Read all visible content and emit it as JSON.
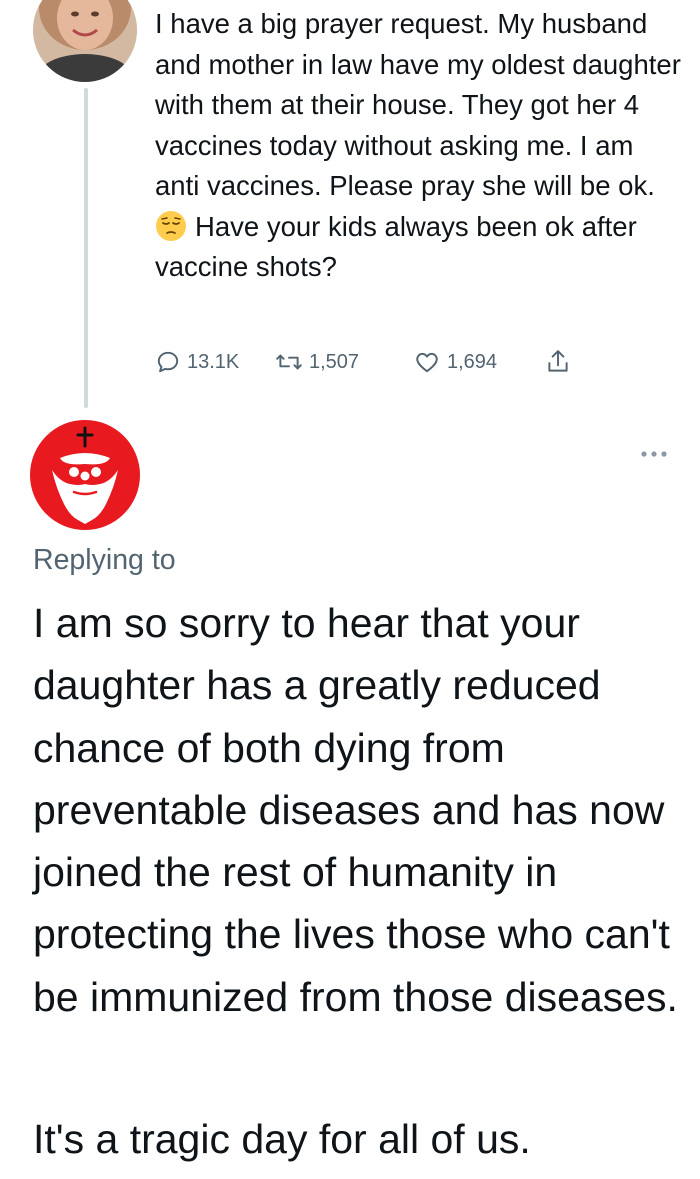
{
  "original_tweet": {
    "text": "I have a big prayer request. My husband and mother in law have my oldest daughter with them at their house. They got her 4 vaccines today without asking me. I am anti vaccines. Please pray she will be ok.",
    "text_after_emoji": "Have your kids always been ok after vaccine shots?",
    "emoji": "pensive-face",
    "replies_count": "13.1K",
    "retweets_count": "1,507",
    "likes_count": "1,694"
  },
  "reply_tweet": {
    "replying_to_label": "Replying to",
    "text_paragraph_1": "I am so sorry to hear that your daughter has a greatly reduced chance of both dying from preventable diseases and has now joined the rest of humanity in protecting the lives those who can't be immunized from those diseases.",
    "text_paragraph_2": "It's a tragic day for all of us."
  },
  "icons": {
    "reply": "speech-bubble-icon",
    "retweet": "retweet-icon",
    "like": "heart-icon",
    "share": "share-icon",
    "more": "more-dots-icon"
  },
  "colors": {
    "text_primary": "#0f1419",
    "text_secondary": "#536471",
    "thread_line": "#cfd9de",
    "reply_avatar_bg": "#e8191f"
  }
}
